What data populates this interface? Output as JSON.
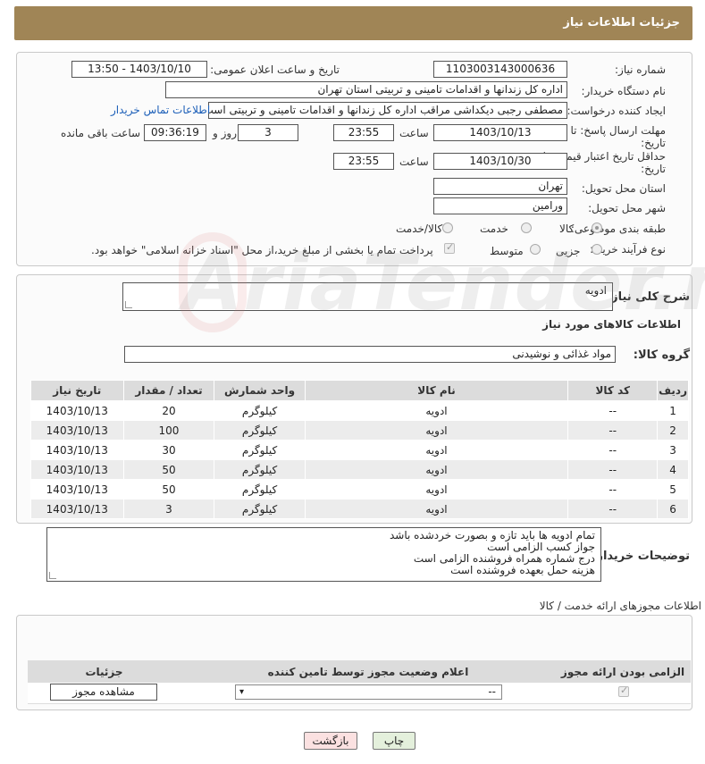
{
  "header": {
    "title": "جزئیات اطلاعات نیاز"
  },
  "form": {
    "need_number_label": "شماره نیاز:",
    "need_number": "1103003143000636",
    "announce_label": "تاریخ و ساعت اعلان عمومی:",
    "announce_value": "1403/10/10 - 13:50",
    "buyer_org_label": "نام دستگاه خریدار:",
    "buyer_org": "اداره کل زندانها و اقدامات تامینی و تربیتی استان تهران",
    "creator_label": "ایجاد کننده درخواست:",
    "creator": "مصطفی رجبی دیکداشی مراقب  اداره کل زندانها و اقدامات تامینی و تربیتی است",
    "contact_link": "اطلاعات تماس خریدار",
    "deadline_label_1": "مهلت ارسال پاسخ: تا",
    "deadline_label_2": "تاریخ:",
    "deadline_date": "1403/10/13",
    "time_word": "ساعت",
    "deadline_time": "23:55",
    "days_value": "3",
    "days_label": "روز و",
    "remaining_time": "09:36:19",
    "remaining_label": "ساعت باقی مانده",
    "validity_label_1": "حداقل تاریخ اعتبار قیمت: تا",
    "validity_label_2": "تاریخ:",
    "validity_date": "1403/10/30",
    "validity_time": "23:55",
    "province_label": "استان محل تحویل:",
    "province": "تهران",
    "city_label": "شهر محل تحویل:",
    "city": "ورامین",
    "category_label": "طبقه بندی موضوعی:",
    "category_options": [
      "کالا",
      "خدمت",
      "کالا/خدمت"
    ],
    "purchase_type_label": "نوع فرآیند خرید :",
    "purchase_options": [
      "جزیی",
      "متوسط"
    ],
    "payment_note": "پرداخت تمام یا بخشی از مبلغ خرید،از محل \"اسناد خزانه اسلامی\" خواهد بود."
  },
  "summary": {
    "label": "شرح کلی نیاز:",
    "value": "ادویه",
    "goods_info_title": "اطلاعات کالاهای مورد نیاز",
    "group_label": "گروه کالا:",
    "group_value": "مواد غذائی و نوشیدنی"
  },
  "table": {
    "headers": [
      "ردیف",
      "کد کالا",
      "نام کالا",
      "واحد شمارش",
      "تعداد / مقدار",
      "تاریخ نیاز"
    ],
    "rows": [
      [
        "1",
        "--",
        "ادویه",
        "کیلوگرم",
        "20",
        "1403/10/13"
      ],
      [
        "2",
        "--",
        "ادویه",
        "کیلوگرم",
        "100",
        "1403/10/13"
      ],
      [
        "3",
        "--",
        "ادویه",
        "کیلوگرم",
        "30",
        "1403/10/13"
      ],
      [
        "4",
        "--",
        "ادویه",
        "کیلوگرم",
        "50",
        "1403/10/13"
      ],
      [
        "5",
        "--",
        "ادویه",
        "کیلوگرم",
        "50",
        "1403/10/13"
      ],
      [
        "6",
        "--",
        "ادویه",
        "کیلوگرم",
        "3",
        "1403/10/13"
      ]
    ]
  },
  "buyer_notes": {
    "label": "توضیحات خریدار:",
    "lines": [
      "تمام ادویه ها باید تازه و بصورت خردشده باشد",
      "جواز کسب الزامی است",
      "درج شماره همراه فروشنده الزامی است",
      "هزینه حمل بعهده فروشنده است"
    ]
  },
  "permits": {
    "title": "اطلاعات مجوزهای ارائه خدمت / کالا",
    "headers": [
      "الزامی بودن ارائه مجوز",
      "اعلام وضعیت مجوز توسط تامین کننده",
      "جزئیات"
    ],
    "select_value": "--",
    "view_button": "مشاهده مجوز"
  },
  "buttons": {
    "print": "چاپ",
    "back": "بازگشت"
  },
  "watermark": {
    "text": "AriaTender.neT"
  }
}
